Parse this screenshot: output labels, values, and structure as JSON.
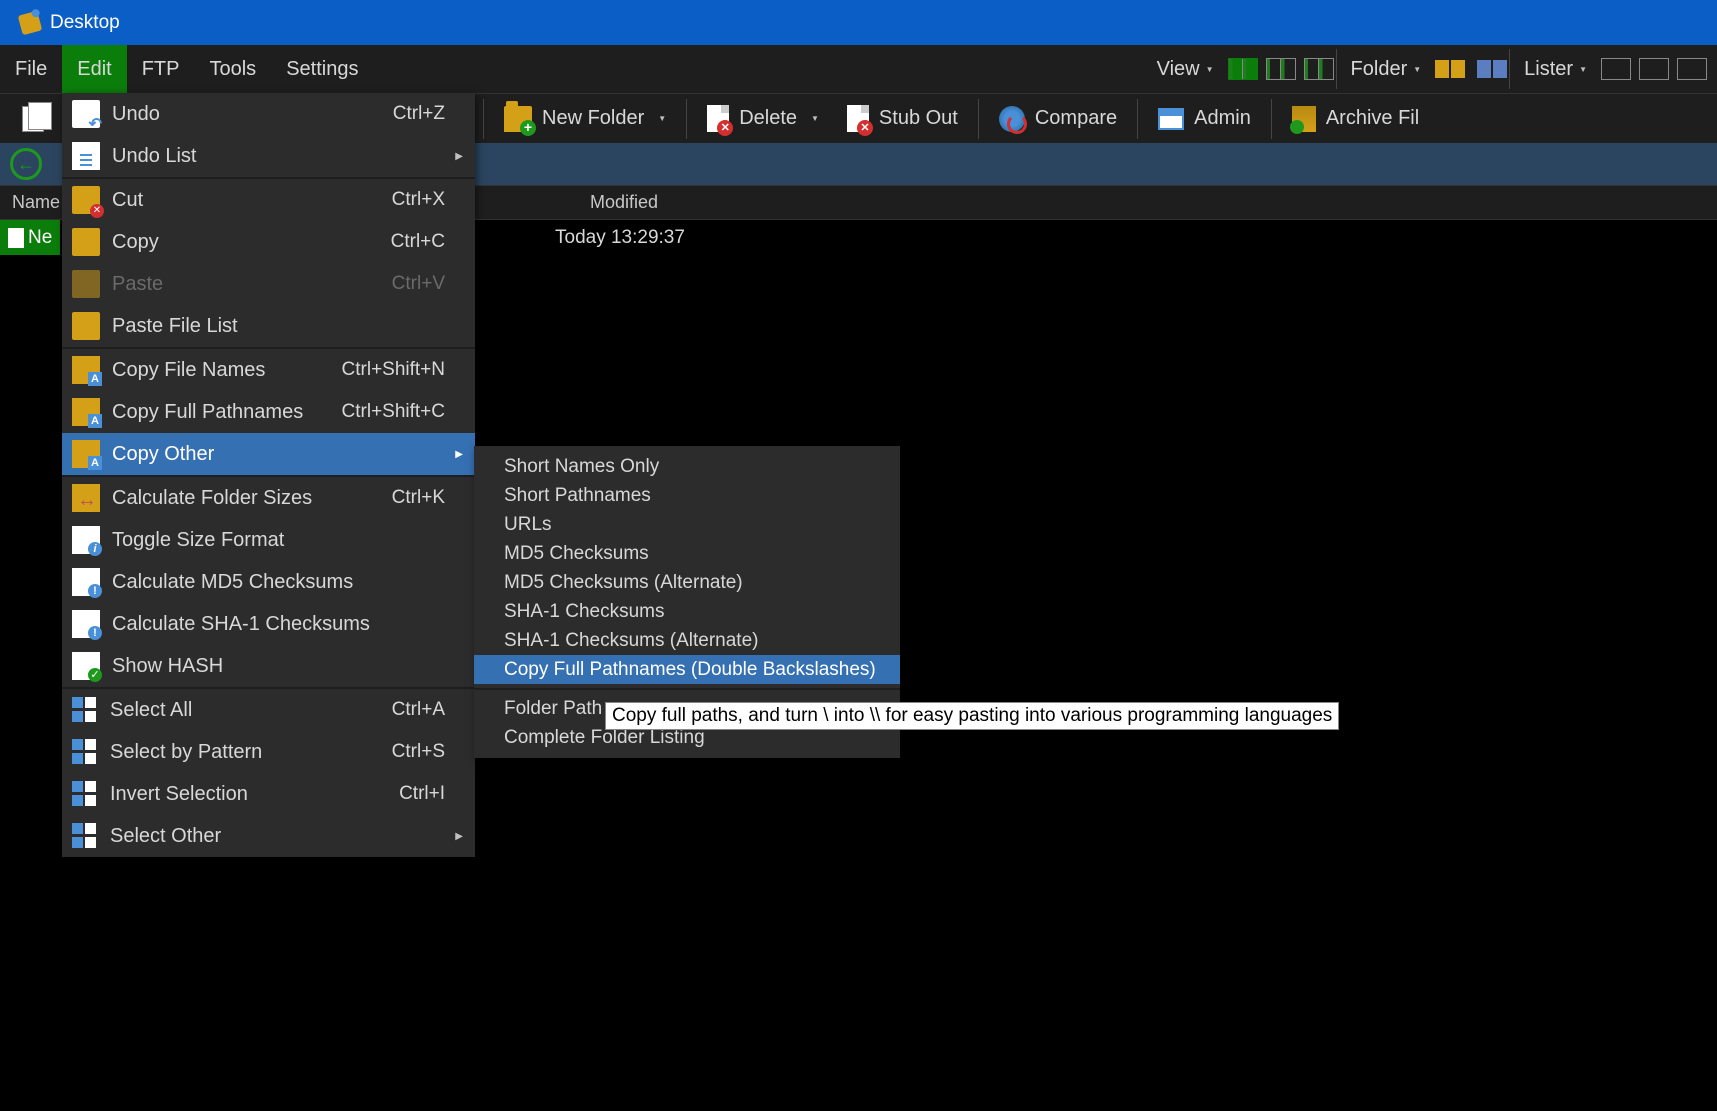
{
  "titlebar": {
    "title": "Desktop"
  },
  "menubar": {
    "items": [
      "File",
      "Edit",
      "FTP",
      "Tools",
      "Settings"
    ],
    "active_index": 1,
    "view_label": "View",
    "folder_label": "Folder",
    "lister_label": "Lister"
  },
  "toolbar": {
    "copy": "Copy",
    "new_folder": "New Folder",
    "delete": "Delete",
    "stub_out": "Stub Out",
    "compare": "Compare",
    "admin": "Admin",
    "archive": "Archive Fil"
  },
  "columns": {
    "name": "Name",
    "modified": "Modified"
  },
  "file_row": {
    "name": "Ne",
    "modified": "Today  13:29:37"
  },
  "edit_menu": [
    {
      "label": "Undo",
      "shortcut": "Ctrl+Z",
      "icon": "di-undo"
    },
    {
      "label": "Undo List",
      "icon": "di-list",
      "submenu": true
    },
    {
      "type": "sep"
    },
    {
      "label": "Cut",
      "shortcut": "Ctrl+X",
      "icon": "di-cut"
    },
    {
      "label": "Copy",
      "shortcut": "Ctrl+C",
      "icon": "di-copy"
    },
    {
      "label": "Paste",
      "shortcut": "Ctrl+V",
      "icon": "di-paste",
      "disabled": true
    },
    {
      "label": "Paste File List",
      "icon": "di-copy"
    },
    {
      "type": "sep"
    },
    {
      "label": "Copy File Names",
      "shortcut": "Ctrl+Shift+N",
      "icon": "di-copyA"
    },
    {
      "label": "Copy Full Pathnames",
      "shortcut": "Ctrl+Shift+C",
      "icon": "di-copyA"
    },
    {
      "label": "Copy Other",
      "icon": "di-copyA",
      "submenu": true,
      "highlighted": true
    },
    {
      "type": "sep"
    },
    {
      "label": "Calculate Folder Sizes",
      "shortcut": "Ctrl+K",
      "icon": "di-calc"
    },
    {
      "label": "Toggle Size Format",
      "icon": "di-doc info"
    },
    {
      "label": "Calculate MD5 Checksums",
      "icon": "di-doc excl"
    },
    {
      "label": "Calculate SHA-1 Checksums",
      "icon": "di-doc excl"
    },
    {
      "label": "Show HASH",
      "icon": "di-hash"
    },
    {
      "type": "sep"
    },
    {
      "label": "Select All",
      "shortcut": "Ctrl+A",
      "icon": "di-sel all"
    },
    {
      "label": "Select by Pattern",
      "shortcut": "Ctrl+S",
      "icon": "di-sel pat"
    },
    {
      "label": "Invert Selection",
      "shortcut": "Ctrl+I",
      "icon": "di-sel inv"
    },
    {
      "label": "Select Other",
      "icon": "di-sel oth",
      "submenu": true
    }
  ],
  "copy_other_menu": [
    {
      "label": "Short Names Only"
    },
    {
      "label": "Short Pathnames"
    },
    {
      "label": "URLs"
    },
    {
      "label": "MD5 Checksums"
    },
    {
      "label": "MD5 Checksums (Alternate)"
    },
    {
      "label": "SHA-1 Checksums"
    },
    {
      "label": "SHA-1 Checksums (Alternate)"
    },
    {
      "label": "Copy Full Pathnames (Double Backslashes)",
      "highlighted": true
    },
    {
      "type": "sep"
    },
    {
      "label": "Folder Path"
    },
    {
      "label": "Complete Folder Listing"
    }
  ],
  "tooltip": "Copy full paths, and turn \\ into \\\\ for easy pasting into various programming languages"
}
